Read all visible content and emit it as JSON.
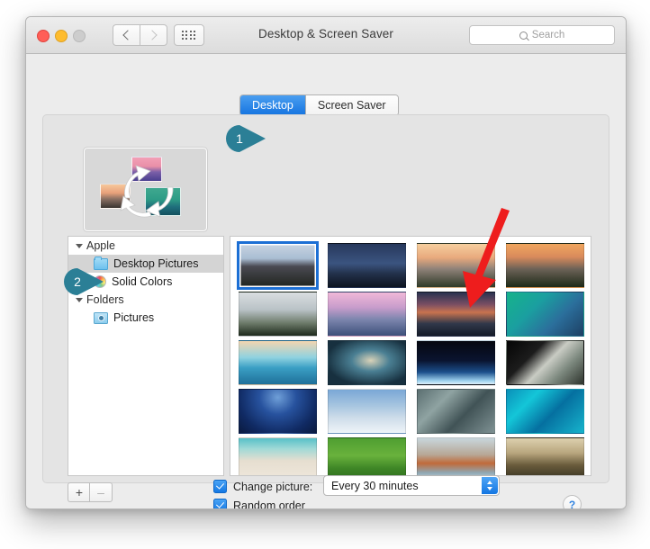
{
  "window": {
    "title": "Desktop & Screen Saver",
    "traffic_lights": [
      "close",
      "minimize",
      "zoom"
    ],
    "nav": {
      "back": "back-arrow",
      "forward": "forward-arrow",
      "show_all": "show-all-grid"
    },
    "search": {
      "placeholder": "Search",
      "icon": "search-icon"
    }
  },
  "tabs": [
    {
      "label": "Desktop",
      "active": true
    },
    {
      "label": "Screen Saver",
      "active": false
    }
  ],
  "preview": {
    "name": "desktop-rotation-preview",
    "icon": "refresh-cycle-icon"
  },
  "sidebar": {
    "groups": [
      {
        "label": "Apple",
        "items": [
          {
            "label": "Desktop Pictures",
            "icon": "folder-icon",
            "selected": true
          },
          {
            "label": "Solid Colors",
            "icon": "color-wheel-icon",
            "selected": false
          }
        ]
      },
      {
        "label": "Folders",
        "items": [
          {
            "label": "Pictures",
            "icon": "pictures-folder-icon",
            "selected": false
          }
        ]
      }
    ]
  },
  "wallpaper_grid": {
    "selected_index": 0,
    "arrow_target_index": 10,
    "thumbnails": [
      {
        "name": "el-capitan",
        "css": "linear-gradient(to bottom,#c8d4e2 0%,#a9bdd2 34%,#4a4a52 52%,#20241e 100%)",
        "accent": "#d4551f"
      },
      {
        "name": "yosemite-night",
        "css": "linear-gradient(to bottom,#27385c 0%,#3b5480 45%,#223049 70%,#0d1420 100%)",
        "accent": "#1a2437"
      },
      {
        "name": "el-capitan-2",
        "css": "linear-gradient(to bottom,#f6cf9f 0%,#e8a97d 32%,#8f8279 58%,#2f3a28 100%)",
        "accent": "#9a8e80"
      },
      {
        "name": "yosemite-sunset",
        "css": "linear-gradient(to bottom,#f0a65e 0%,#d98a5c 30%,#6d6257 58%,#1d2a18 100%)",
        "accent": "#c07a4d"
      },
      {
        "name": "yosemite-fog",
        "css": "linear-gradient(to bottom,#d9dde0 0%,#b9c2c6 40%,#6f7d6c 70%,#1e2a1c 100%)",
        "accent": "#9aa5a3"
      },
      {
        "name": "yosemite-dusk",
        "css": "linear-gradient(to bottom,#f0b8d8 0%,#c79ccb 35%,#7d86ae 62%,#3d4f7a 100%)",
        "accent": "#b48fc0"
      },
      {
        "name": "lake-sunset",
        "css": "linear-gradient(to bottom,#2a3350 0%,#7b4f63 28%,#c8734f 46%,#31384a 72%,#151b28 100%)",
        "accent": "#c8734f"
      },
      {
        "name": "mavericks-wave",
        "css": "linear-gradient(135deg,#16b38a 0%,#1a9fa0 35%,#2b6f9c 65%,#1d3f63 100%)",
        "accent": "#16b38a"
      },
      {
        "name": "blue-wave",
        "css": "linear-gradient(to bottom,#f3d5b0 0%,#8fd2e0 38%,#3a9fc4 62%,#1f6f99 100%)",
        "accent": "#3a9fc4"
      },
      {
        "name": "dark-wave",
        "css": "radial-gradient(ellipse at 55% 45%, #d8d2b8 0%, #4a7f93 32%, #17303f 75%)",
        "accent": "#4a7f93"
      },
      {
        "name": "earth-horizon",
        "css": "linear-gradient(to bottom,#05070f 0%,#0a1430 45%,#1b4f8c 72%,#9fd3ef 92%,#dff0fa 100%)",
        "accent": "#9fd3ef"
      },
      {
        "name": "ice-ridge",
        "css": "linear-gradient(135deg,#050505 0%,#1c1c1c 32%,#c9ccc4 52%,#7e8a80 72%,#2d332c 100%)",
        "accent": "#c9ccc4"
      },
      {
        "name": "milky-way-blue",
        "css": "radial-gradient(ellipse at 50% 18%, #6f9fd8 0%, #27529e 34%, #102a63 72%, #0a1a3f 100%)",
        "accent": "#27529e"
      },
      {
        "name": "crescent-moon",
        "css": "linear-gradient(to bottom,#7aa7d6 0%,#a8c6e0 38%,#cfddea 66%,#eef4f8 100%)",
        "accent": "#cfddea"
      },
      {
        "name": "grey-clouds",
        "css": "linear-gradient(135deg,#5b6f71 0%,#8fa3a2 30%,#415356 60%,#7e9193 100%)",
        "accent": "#8fa3a2"
      },
      {
        "name": "turquoise-swirl",
        "css": "linear-gradient(135deg,#0a90b8 0%,#14c6d8 28%,#0570a0 58%,#17b3cc 100%)",
        "accent": "#14c6d8"
      },
      {
        "name": "beach-shore",
        "css": "linear-gradient(to bottom,#57c0c8 0%,#9fd9d6 24%,#e6ded0 52%,#efe8dc 100%)",
        "accent": "#9fd9d6"
      },
      {
        "name": "green-fields",
        "css": "linear-gradient(to bottom,#4f9e31 0%,#69b23c 40%,#3e8526 70%,#2c6a1c 100%)",
        "accent": "#69b23c"
      },
      {
        "name": "misty-coast",
        "css": "linear-gradient(to bottom,#c8d6dc 0%,#b7a796 38%,#c06a3a 58%,#8fa8b4 80%,#d8dfe2 100%)",
        "accent": "#c06a3a"
      },
      {
        "name": "desert-dunes",
        "css": "linear-gradient(to bottom,#ddd0ae 0%,#b8a67e 34%,#6a5c3c 62%,#2e2a1c 100%)",
        "accent": "#b8a67e"
      }
    ]
  },
  "bottom": {
    "add_label": "+",
    "remove_label": "–",
    "change_picture": {
      "label": "Change picture:",
      "checked": true
    },
    "interval": {
      "value": "Every 30 minutes"
    },
    "random_order": {
      "label": "Random order",
      "checked": true
    },
    "help_label": "?"
  },
  "callouts": [
    {
      "number": "1",
      "target": "desktop-tab"
    },
    {
      "number": "2",
      "target": "sidebar-desktop-pictures"
    }
  ],
  "annotation": {
    "arrow": {
      "color": "#ee1d1d",
      "name": "red-pointer-arrow"
    }
  },
  "colors": {
    "accent_blue": "#1478e4",
    "callout_teal": "#2b7f96",
    "selection_blue": "#1c6fd4",
    "window_bg": "#ececec",
    "panel_bg": "#e4e4e4"
  }
}
